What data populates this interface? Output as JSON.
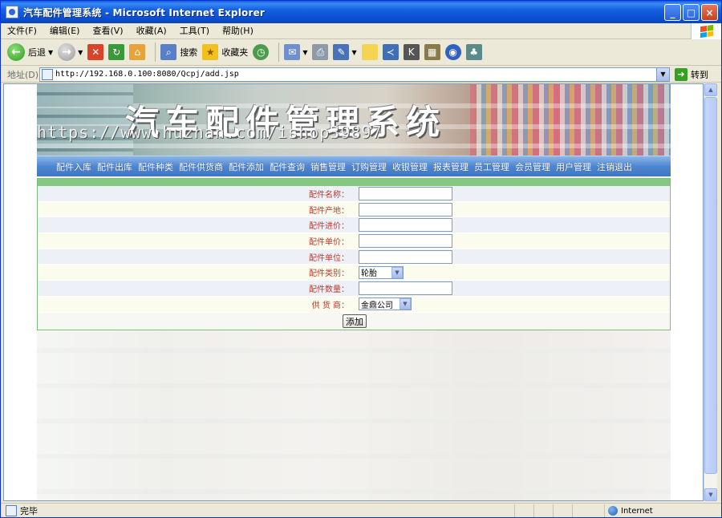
{
  "window": {
    "title": "汽车配件管理系统 - Microsoft Internet Explorer",
    "controls": [
      "_",
      "□",
      "×"
    ]
  },
  "menu": [
    "文件(F)",
    "编辑(E)",
    "查看(V)",
    "收藏(A)",
    "工具(T)",
    "帮助(H)"
  ],
  "toolbar": {
    "back_label": "后退",
    "search_label": "搜索",
    "favorites_label": "收藏夹"
  },
  "address": {
    "label": "地址(D)",
    "url": "http://192.168.0.100:8080/Qcpj/add.jsp",
    "go_label": "转到"
  },
  "banner": {
    "title": "汽车配件管理系统",
    "watermark": "https://www.huzhan.com/ishop39897"
  },
  "nav": [
    "配件入库",
    "配件出库",
    "配件种类",
    "配件供货商",
    "配件添加",
    "配件查询",
    "销售管理",
    "订购管理",
    "收银管理",
    "报表管理",
    "员工管理",
    "会员管理",
    "用户管理",
    "注销退出"
  ],
  "form": {
    "fields": [
      {
        "label": "配件名称：",
        "type": "text",
        "value": ""
      },
      {
        "label": "配件产地：",
        "type": "text",
        "value": ""
      },
      {
        "label": "配件进价：",
        "type": "text",
        "value": ""
      },
      {
        "label": "配件单价：",
        "type": "text",
        "value": ""
      },
      {
        "label": "配件单位：",
        "type": "text",
        "value": ""
      },
      {
        "label": "配件类别：",
        "type": "select",
        "value": "轮胎"
      },
      {
        "label": "配件数量：",
        "type": "text",
        "value": ""
      },
      {
        "label": "供 货 商：",
        "type": "select",
        "value": "金鼎公司"
      }
    ],
    "submit_label": "添加"
  },
  "status": {
    "text": "完毕",
    "zone": "Internet"
  }
}
